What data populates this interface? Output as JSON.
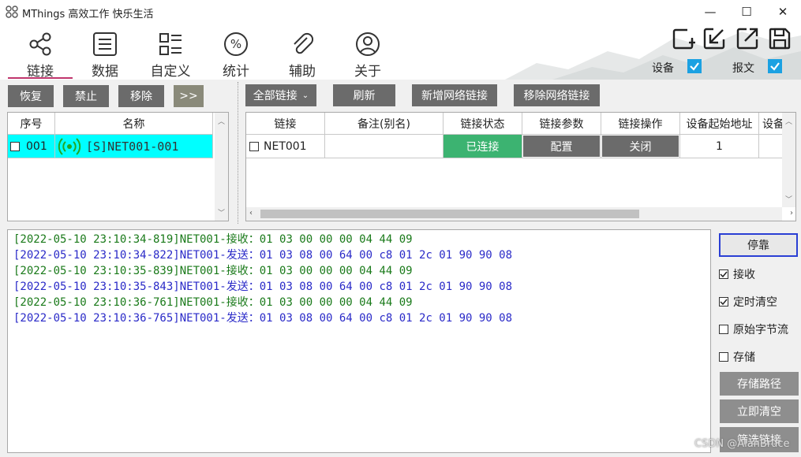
{
  "window": {
    "title": "MThings 高效工作 快乐生活",
    "minimize": "—",
    "maximize": "☐",
    "close": "✕"
  },
  "nav": {
    "tabs": [
      {
        "label": "链接",
        "icon": "share-icon",
        "active": true
      },
      {
        "label": "数据",
        "icon": "list-icon"
      },
      {
        "label": "自定义",
        "icon": "grid-list-icon"
      },
      {
        "label": "统计",
        "icon": "percent-icon"
      },
      {
        "label": "辅助",
        "icon": "paperclip-icon"
      },
      {
        "label": "关于",
        "icon": "user-icon"
      }
    ],
    "accent": "#c0356c"
  },
  "header_controls": {
    "device_label": "设备",
    "message_label": "报文",
    "device_checked": true,
    "message_checked": true,
    "check_color": "#1ba1e2"
  },
  "left_toolbar": {
    "restore": "恢复",
    "disable": "禁止",
    "remove": "移除",
    "more": ">>"
  },
  "left_table": {
    "headers": [
      "序号",
      "名称"
    ],
    "rows": [
      {
        "index": "001",
        "name": "[S]NET001-001",
        "checked": false
      }
    ],
    "highlight_color": "#00ffff"
  },
  "right_toolbar": {
    "all_links": "全部链接",
    "refresh": "刷新",
    "add_network": "新增网络链接",
    "remove_network": "移除网络链接"
  },
  "link_table": {
    "headers": [
      "链接",
      "备注(别名)",
      "链接状态",
      "链接参数",
      "链接操作",
      "设备起始地址",
      "设备"
    ],
    "rows": [
      {
        "link": "NET001",
        "alias": "",
        "status": "已连接",
        "params": "配置",
        "action": "关闭",
        "start_address": "1",
        "checked": false
      }
    ],
    "status_color": "#3cb371"
  },
  "log": {
    "lines": [
      {
        "type": "recv",
        "time": "[2022-05-10 23:10:34-819]",
        "source": "NET001-接收：",
        "bytes": "01 03 00 00 00 04 44 09"
      },
      {
        "type": "send",
        "time": "[2022-05-10 23:10:34-822]",
        "source": "NET001-发送：",
        "bytes": "01 03 08 00 64 00 c8 01 2c 01 90 90 08"
      },
      {
        "type": "recv",
        "time": "[2022-05-10 23:10:35-839]",
        "source": "NET001-接收：",
        "bytes": "01 03 00 00 00 04 44 09"
      },
      {
        "type": "send",
        "time": "[2022-05-10 23:10:35-843]",
        "source": "NET001-发送：",
        "bytes": "01 03 08 00 64 00 c8 01 2c 01 90 90 08"
      },
      {
        "type": "recv",
        "time": "[2022-05-10 23:10:36-761]",
        "source": "NET001-接收：",
        "bytes": "01 03 00 00 00 04 44 09"
      },
      {
        "type": "send",
        "time": "[2022-05-10 23:10:36-765]",
        "source": "NET001-发送：",
        "bytes": "01 03 08 00 64 00 c8 01 2c 01 90 90 08"
      }
    ]
  },
  "log_controls": {
    "pause": "停靠",
    "receive": "接收",
    "timed_clear": "定时清空",
    "raw_stream": "原始字节流",
    "store": "存储",
    "store_path": "存储路径",
    "clear_now": "立即清空",
    "filter_links": "筛选链接",
    "receive_checked": true,
    "timed_clear_checked": true,
    "raw_stream_checked": false,
    "store_checked": false
  },
  "watermark": "CSDN @AlanBruce"
}
